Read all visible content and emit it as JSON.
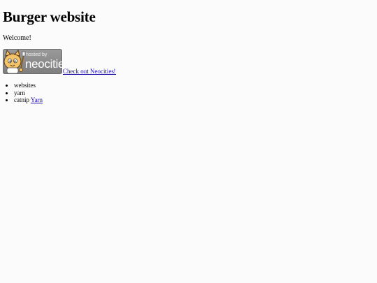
{
  "page": {
    "title": "Burger website",
    "welcome": "Welcome!",
    "badge": {
      "hosted_text": "hosted by",
      "name_text": "neocities",
      "link_text": "Check out Neocities!"
    },
    "list": [
      {
        "text": "websites"
      },
      {
        "text": "yarn"
      },
      {
        "text": "catnip",
        "link": "Yarn"
      }
    ]
  },
  "colors": {
    "background": "#fbfbfb",
    "link": "#1a0dab",
    "badge": "#8a8a8a"
  }
}
